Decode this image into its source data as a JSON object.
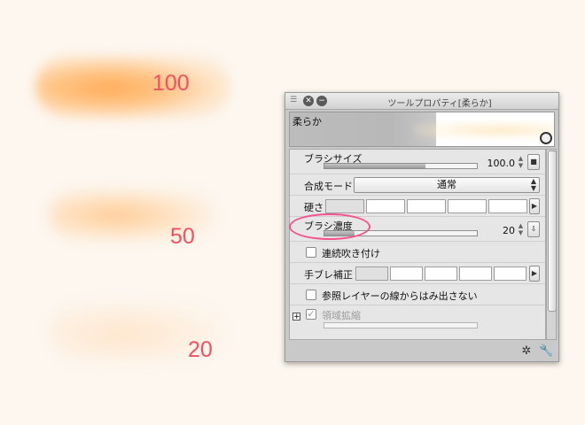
{
  "samples": [
    {
      "label": "100"
    },
    {
      "label": "50"
    },
    {
      "label": "20"
    }
  ],
  "panel": {
    "title": "ツールプロパティ[柔らか]",
    "preview_label": "柔らか",
    "brush_size": {
      "label": "ブラシサイズ",
      "value": "100.0",
      "fill_fraction": 0.66
    },
    "blend_mode": {
      "label": "合成モード",
      "value": "通常"
    },
    "hardness": {
      "label": "硬さ",
      "selected_index": 0,
      "count": 5
    },
    "brush_density": {
      "label": "ブラシ濃度",
      "value": "20",
      "fill_fraction": 0.2
    },
    "continuous_spray": {
      "label": "連続吹き付け",
      "checked": false
    },
    "stabilization": {
      "label": "手ブレ補正",
      "selected_index": 0,
      "count": 5
    },
    "reference_layer": {
      "label": "参照レイヤーの線からはみ出さない",
      "checked": false
    },
    "area_expansion": {
      "label": "領域拡縮",
      "checked": true,
      "enabled": false
    }
  },
  "colors": {
    "sample_text": "#f05060",
    "highlight": "#f2538b",
    "brush_orange": "#ffa850"
  },
  "icons": [
    "close-icon",
    "minimize-icon",
    "zoom-icon",
    "spin-icon",
    "square-icon",
    "arrow-right-icon",
    "expand-plus-icon",
    "reset-icon",
    "wrench-icon"
  ]
}
